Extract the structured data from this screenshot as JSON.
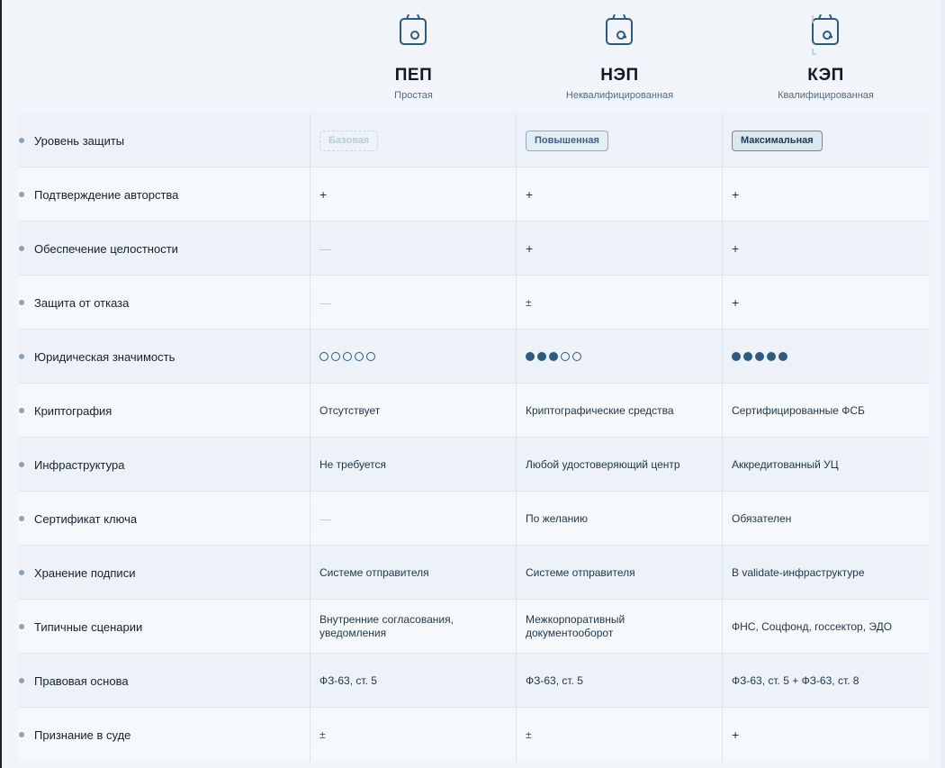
{
  "plans": [
    {
      "name": "ПЕП",
      "subtitle": "Простая"
    },
    {
      "name": "НЭП",
      "subtitle": "Неквалифицированная"
    },
    {
      "name": "КЭП",
      "subtitle": "Квалифицированная"
    }
  ],
  "rows": [
    {
      "label": "Уровень защиты",
      "values": [
        "Базовая",
        "Повышенная",
        "Максимальная"
      ]
    },
    {
      "label": "Подтверждение авторства",
      "values": [
        "+",
        "+",
        "+"
      ]
    },
    {
      "label": "Обеспечение целостности",
      "values": [
        "—",
        "+",
        "+"
      ]
    },
    {
      "label": "Защита от отказа",
      "values": [
        "—",
        "±",
        "+"
      ]
    },
    {
      "label": "Юридическая значимость",
      "rating": [
        0,
        3,
        5
      ],
      "rating_max": 5
    },
    {
      "label": "Криптография",
      "values": [
        "Отсутствует",
        "Криптографические средства",
        "Сертифицированные ФСБ"
      ]
    },
    {
      "label": "Инфраструктура",
      "values": [
        "Не требуется",
        "Любой удостоверяющий центр",
        "Аккредитованный УЦ"
      ]
    },
    {
      "label": "Сертификат ключа",
      "values": [
        "—",
        "По желанию",
        "Обязателен"
      ]
    },
    {
      "label": "Хранение подписи",
      "values": [
        "Системе отправителя",
        "Системе отправителя",
        "В validate-инфраструктуре"
      ]
    },
    {
      "label": "Типичные сценарии",
      "values": [
        "Внутренние согласования, уведомления",
        "Межкорпоративный документооборот",
        "ФНС, Соцфонд, госсектор, ЭДО"
      ]
    },
    {
      "label": "Правовая основа",
      "values": [
        "ФЗ-63, ст. 5",
        "ФЗ-63, ст. 5",
        "ФЗ-63, ст. 5 + ФЗ-63, ст. 8"
      ]
    },
    {
      "label": "Признание в суде",
      "values": [
        "±",
        "±",
        "+"
      ]
    }
  ],
  "icons": [
    "document-lock-icon",
    "document-key-icon",
    "document-seal-icon"
  ],
  "colors": {
    "accent": "#2d5a80",
    "row_alt": "#ecf2f7",
    "row": "#f5f9fc",
    "bullet": "#8aa3ba"
  }
}
